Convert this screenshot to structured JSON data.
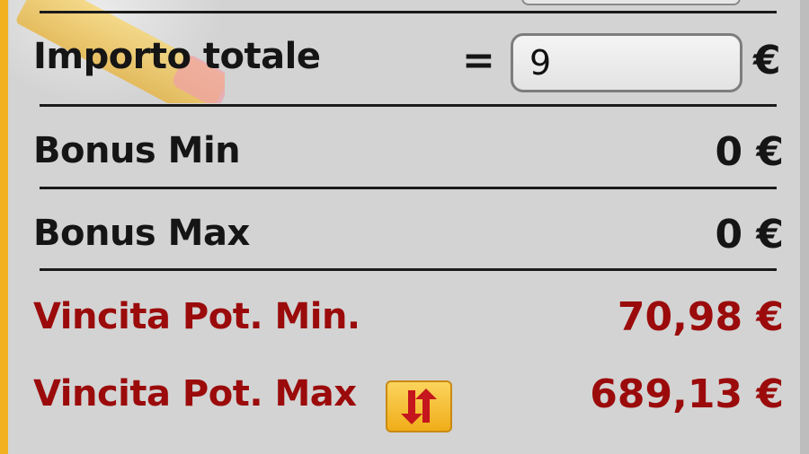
{
  "summary": {
    "total_amount": {
      "label": "Importo totale",
      "equals": "=",
      "value": "9",
      "currency": "€"
    },
    "bonus_min": {
      "label": "Bonus Min",
      "value": "0 €"
    },
    "bonus_max": {
      "label": "Bonus Max",
      "value": "0 €"
    },
    "potential_win_min": {
      "label": "Vincita Pot. Min.",
      "value": "70,98 €"
    },
    "potential_win_max": {
      "label": "Vincita Pot. Max",
      "value": "689,13 €"
    }
  },
  "icons": {
    "swap": "swap-arrows-icon",
    "decoration": "pencil-icon"
  },
  "colors": {
    "accent_bar": "#f2b21f",
    "panel_background": "#d3d3d3",
    "potential_win_text": "#9b0b0b",
    "swap_button": "#f0ad1a",
    "swap_arrows": "#c4161c"
  }
}
